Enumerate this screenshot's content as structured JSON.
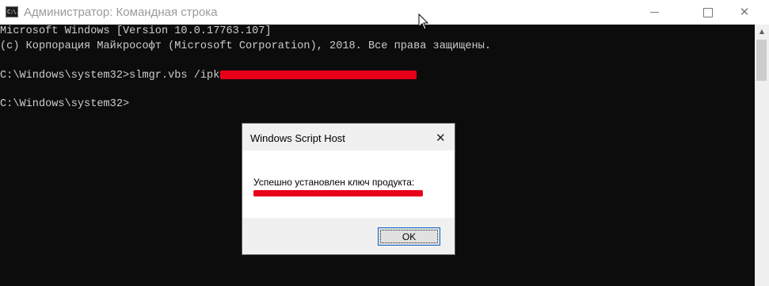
{
  "window": {
    "icon_text": "C:\\.",
    "title": "Администратор: Командная строка",
    "buttons": {
      "minimize": "—",
      "maximize": "☐",
      "close": "✕"
    }
  },
  "console": {
    "lines": [
      "Microsoft Windows [Version 10.0.17763.107]",
      "(c) Корпорация Майкрософт (Microsoft Corporation), 2018. Все права защищены.",
      "C:\\Windows\\system32>slmgr.vbs /ipk",
      "C:\\Windows\\system32>"
    ]
  },
  "dialog": {
    "title": "Windows Script Host",
    "close": "✕",
    "message": "Успешно установлен ключ продукта:",
    "ok_label": "OK"
  },
  "colors": {
    "console_bg": "#0c0c0c",
    "console_text": "#cccccc",
    "redaction": "#e8001a"
  }
}
